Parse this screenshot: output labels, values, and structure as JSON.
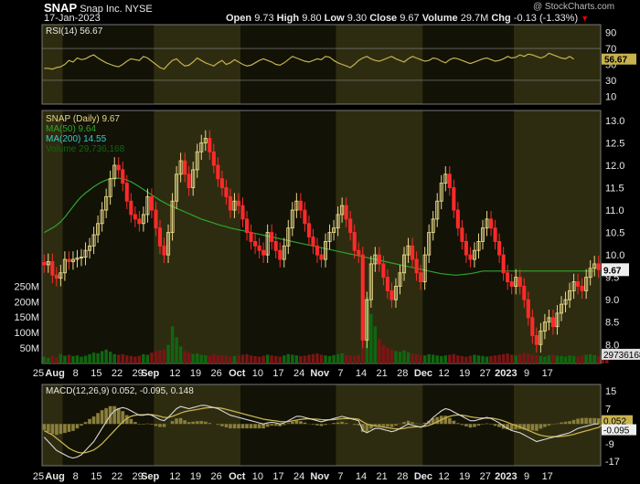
{
  "header": {
    "symbol": "SNAP",
    "company": "Snap Inc.",
    "exchange": "NYSE",
    "date": "17-Jan-2023",
    "open_label": "Open",
    "open": "9.73",
    "high_label": "High",
    "high": "9.80",
    "low_label": "Low",
    "low": "9.30",
    "close_label": "Close",
    "close": "9.67",
    "volume_label": "Volume",
    "volume": "29.7M",
    "chg_label": "Chg",
    "chg": "-0.13 (-1.33%)",
    "chg_arrow": "▼",
    "watermark": "@ StockCharts.com"
  },
  "colors": {
    "background": "#000000",
    "panel_band_dark": "#121207",
    "panel_band_light": "#2e2c10",
    "up_candle": "#e8d88a",
    "down_candle": "#ff2a2a",
    "ma50": "#2ea52e",
    "ma200": "#3ac9c9",
    "volume": "#116611",
    "rsi_line": "#c7b24f",
    "macd_line": "#d8d8d8",
    "signal_line": "#c7b24f",
    "axis_text": "#e8e8e8"
  },
  "chart_data": [
    {
      "type": "line",
      "panel": "rsi",
      "legend": "RSI(14) 56.67",
      "yticks": [
        10,
        30,
        50,
        70,
        90
      ],
      "ylim": [
        0,
        100
      ],
      "last_label": "56.67",
      "values": [
        45,
        45,
        44,
        46,
        47,
        50,
        55,
        53,
        58,
        56,
        57,
        60,
        62,
        58,
        55,
        52,
        50,
        48,
        47,
        50,
        54,
        57,
        56,
        55,
        60,
        58,
        54,
        50,
        46,
        44,
        50,
        55,
        57,
        52,
        48,
        49,
        53,
        58,
        55,
        52,
        50,
        48,
        52,
        55,
        50,
        52,
        56,
        53,
        50,
        48,
        49,
        52,
        55,
        57,
        55,
        53,
        50,
        49,
        52,
        56,
        60,
        58,
        56,
        54,
        53,
        55,
        57,
        56,
        60,
        59,
        55,
        52,
        50,
        48,
        46,
        50,
        55,
        58,
        60,
        57,
        55,
        54,
        56,
        58,
        60,
        57,
        55,
        53,
        57,
        60,
        58,
        56,
        54,
        55,
        58,
        57,
        54,
        52,
        56,
        58,
        57,
        55,
        53,
        51,
        53,
        55,
        57,
        58,
        56,
        54,
        55,
        57,
        60,
        58,
        59,
        62,
        60,
        63,
        62,
        60,
        58,
        60,
        64,
        62,
        60,
        58,
        57,
        60,
        56.67
      ]
    },
    {
      "type": "candlestick",
      "panel": "price",
      "legend": [
        "SNAP (Daily) 9.67",
        "MA(50) 9.64",
        "MA(200) 14.55",
        "Volume 29,736,168"
      ],
      "yticks": [
        "8.0",
        "8.5",
        "9.0",
        "9.5",
        "10.0",
        "10.5",
        "11.0",
        "11.5",
        "12.0",
        "12.5",
        "13.0"
      ],
      "ylim": [
        7.7,
        13.1
      ],
      "last_price_label": "9.67",
      "volume_ticks": [
        "50M",
        "100M",
        "150M",
        "200M",
        "250M"
      ],
      "volume_ylim": [
        0,
        260
      ],
      "last_volume_label": "29736168",
      "close": [
        9.78,
        9.85,
        9.55,
        9.48,
        9.6,
        9.9,
        9.85,
        9.9,
        9.93,
        9.95,
        10.1,
        10.2,
        10.45,
        10.7,
        11.0,
        11.3,
        11.7,
        12.0,
        11.9,
        11.6,
        11.2,
        10.9,
        10.8,
        10.7,
        10.9,
        11.3,
        11.0,
        10.6,
        10.2,
        10.0,
        10.5,
        11.2,
        11.8,
        12.1,
        11.8,
        11.5,
        11.9,
        12.3,
        12.5,
        12.6,
        12.3,
        12.0,
        11.7,
        11.5,
        11.3,
        11.0,
        11.2,
        11.1,
        10.8,
        10.5,
        10.3,
        10.2,
        10.1,
        10.0,
        10.5,
        10.3,
        10.1,
        9.9,
        10.2,
        10.6,
        11.0,
        11.2,
        11.0,
        10.7,
        10.4,
        10.2,
        10.0,
        9.9,
        10.3,
        10.5,
        10.6,
        10.9,
        11.1,
        10.8,
        10.5,
        10.1,
        10.0,
        8.1,
        9.0,
        9.8,
        10.0,
        9.8,
        9.5,
        9.2,
        9.0,
        9.3,
        9.6,
        10.0,
        10.2,
        9.9,
        9.6,
        9.4,
        10.0,
        10.5,
        10.8,
        11.2,
        11.6,
        11.8,
        11.5,
        11.0,
        10.6,
        10.3,
        10.0,
        9.9,
        10.1,
        10.3,
        10.6,
        10.8,
        10.6,
        10.3,
        10.0,
        9.6,
        9.4,
        9.3,
        9.5,
        9.3,
        9.0,
        8.6,
        8.2,
        8.0,
        8.3,
        8.5,
        8.6,
        8.4,
        8.7,
        8.9,
        9.0,
        9.2,
        9.4,
        9.3,
        9.2,
        9.5,
        9.7,
        9.8,
        9.67
      ],
      "ma50": [
        10.5,
        10.55,
        10.6,
        10.66,
        10.74,
        10.84,
        10.96,
        11.08,
        11.2,
        11.3,
        11.38,
        11.45,
        11.52,
        11.58,
        11.63,
        11.67,
        11.7,
        11.71,
        11.71,
        11.7,
        11.67,
        11.63,
        11.58,
        11.52,
        11.46,
        11.4,
        11.34,
        11.28,
        11.22,
        11.17,
        11.12,
        11.08,
        11.04,
        11.0,
        10.96,
        10.92,
        10.88,
        10.84,
        10.8,
        10.77,
        10.74,
        10.71,
        10.68,
        10.65,
        10.63,
        10.6,
        10.58,
        10.56,
        10.54,
        10.52,
        10.5,
        10.48,
        10.46,
        10.44,
        10.42,
        10.4,
        10.38,
        10.36,
        10.34,
        10.32,
        10.3,
        10.28,
        10.26,
        10.24,
        10.22,
        10.2,
        10.18,
        10.16,
        10.14,
        10.12,
        10.1,
        10.08,
        10.06,
        10.04,
        10.02,
        10.0,
        9.98,
        9.96,
        9.94,
        9.92,
        9.9,
        9.88,
        9.86,
        9.84,
        9.82,
        9.8,
        9.78,
        9.76,
        9.74,
        9.72,
        9.7,
        9.68,
        9.66,
        9.64,
        9.62,
        9.6,
        9.58,
        9.57,
        9.56,
        9.55,
        9.55,
        9.56,
        9.57,
        9.58,
        9.6,
        9.62,
        9.64,
        9.64,
        9.64,
        9.64,
        9.64,
        9.64,
        9.64,
        9.64,
        9.64,
        9.64,
        9.64,
        9.64,
        9.64,
        9.64,
        9.64,
        9.64,
        9.64,
        9.64,
        9.64,
        9.64,
        9.64,
        9.64,
        9.64,
        9.64,
        9.64,
        9.64,
        9.64,
        9.64
      ],
      "volume": [
        22,
        18,
        25,
        20,
        30,
        25,
        28,
        24,
        26,
        22,
        25,
        30,
        35,
        33,
        40,
        45,
        38,
        30,
        28,
        30,
        26,
        24,
        22,
        25,
        30,
        28,
        35,
        40,
        42,
        45,
        60,
        120,
        85,
        55,
        40,
        35,
        30,
        32,
        28,
        26,
        24,
        30,
        28,
        26,
        25,
        22,
        24,
        26,
        28,
        30,
        26,
        24,
        22,
        25,
        28,
        26,
        24,
        22,
        26,
        30,
        28,
        26,
        24,
        25,
        28,
        30,
        32,
        28,
        26,
        24,
        27,
        30,
        33,
        28,
        26,
        24,
        28,
        180,
        215,
        160,
        120,
        80,
        60,
        50,
        45,
        40,
        38,
        42,
        36,
        32,
        30,
        28,
        26,
        30,
        28,
        26,
        24,
        26,
        28,
        30,
        26,
        24,
        22,
        25,
        28,
        26,
        24,
        22,
        24,
        26,
        28,
        30,
        32,
        28,
        26,
        30,
        35,
        32,
        28,
        26,
        24,
        22,
        26,
        28,
        25,
        24,
        22,
        26,
        24,
        22,
        25,
        28,
        30,
        27,
        24,
        26,
        29.7
      ]
    },
    {
      "type": "line",
      "panel": "macd",
      "legend": "MACD(12,26,9) 0.052, -0.095, 0.148",
      "yticks": [
        -17,
        -9,
        -1,
        7,
        15
      ],
      "ylim": [
        -19,
        18
      ],
      "last_labels": [
        "0.052",
        "-0.095"
      ],
      "macd": [
        -6,
        -8,
        -10,
        -12,
        -13,
        -14,
        -15,
        -15.5,
        -15,
        -14,
        -12,
        -10,
        -8,
        -5,
        -2,
        1,
        4,
        6,
        7,
        7.5,
        7,
        6,
        5,
        4,
        4,
        4.5,
        4,
        3,
        2,
        1.5,
        3,
        5,
        7,
        8,
        7.5,
        7,
        7.5,
        8,
        8.5,
        8.5,
        8,
        7.5,
        7,
        6,
        5,
        4,
        3.5,
        3,
        2.5,
        2,
        1.5,
        1,
        0.5,
        0,
        0.5,
        0.8,
        0.5,
        0,
        0.5,
        1.5,
        2.5,
        3.5,
        3.5,
        3,
        2.5,
        2,
        1.5,
        1,
        1.5,
        2,
        2.5,
        3,
        3.5,
        3,
        2.5,
        2,
        1.5,
        -3,
        -4,
        -3,
        -2,
        -2,
        -2.5,
        -3,
        -3.5,
        -3,
        -2,
        -1,
        0,
        -0.5,
        -1,
        -1.5,
        -0.5,
        1,
        3,
        4.5,
        6,
        7,
        6.5,
        5.5,
        4.5,
        3.5,
        2.5,
        1.5,
        1.5,
        2,
        2.5,
        3,
        2.5,
        1.5,
        0.5,
        -1,
        -2,
        -3,
        -3.5,
        -4,
        -5,
        -6,
        -7,
        -8,
        -7.5,
        -7,
        -6.5,
        -6,
        -5.5,
        -5,
        -4.5,
        -4,
        -3,
        -2,
        -1.5,
        -1,
        -0.5,
        0,
        0.052
      ],
      "signal": [
        -3,
        -4,
        -5,
        -6.5,
        -8,
        -9.5,
        -11,
        -12,
        -12.8,
        -13.2,
        -13,
        -12.5,
        -11.8,
        -10.5,
        -9,
        -7,
        -5,
        -3,
        -1,
        1,
        2.5,
        3.5,
        4,
        4.2,
        4.2,
        4.3,
        4.3,
        4,
        3.5,
        3,
        3,
        3.5,
        4.2,
        5,
        5.6,
        6,
        6.3,
        6.6,
        7,
        7.3,
        7.5,
        7.5,
        7.4,
        7.1,
        6.7,
        6.2,
        5.7,
        5.2,
        4.7,
        4.2,
        3.7,
        3.2,
        2.7,
        2.2,
        1.9,
        1.6,
        1.4,
        1.1,
        1,
        1.1,
        1.4,
        1.8,
        2.1,
        2.3,
        2.4,
        2.3,
        2.2,
        2,
        1.9,
        1.9,
        2,
        2.2,
        2.4,
        2.5,
        2.5,
        2.4,
        2.2,
        1,
        0,
        -0.6,
        -0.9,
        -1.1,
        -1.4,
        -1.7,
        -2,
        -2.2,
        -2.2,
        -2,
        -1.6,
        -1.4,
        -1.3,
        -1.3,
        -1.1,
        -0.6,
        0.1,
        1,
        1.9,
        2.8,
        3.5,
        3.9,
        4.1,
        4,
        3.7,
        3.3,
        3,
        2.8,
        2.7,
        2.7,
        2.7,
        2.4,
        2,
        1.4,
        0.7,
        0,
        -0.7,
        -1.4,
        -2.1,
        -2.9,
        -3.7,
        -4.5,
        -5.1,
        -5.5,
        -5.7,
        -5.8,
        -5.8,
        -5.6,
        -5.4,
        -5.1,
        -4.7,
        -4.1,
        -3.6,
        -3.1,
        -2.6,
        -2.1,
        -1.6,
        -0.095
      ],
      "histogram": [
        -3,
        -4,
        -5,
        -5.5,
        -5,
        -4.5,
        -4,
        -3.5,
        -2.2,
        -0.8,
        1,
        2.5,
        3.8,
        5.5,
        7,
        8,
        9,
        9,
        8,
        6.5,
        4.5,
        2.5,
        1,
        -0.2,
        -0.2,
        0.2,
        -0.3,
        -1,
        -1.5,
        -1.5,
        0,
        1.5,
        2.8,
        3,
        1.9,
        1,
        1.2,
        1.4,
        1.5,
        1.2,
        0.5,
        0,
        -0.4,
        -1.1,
        -1.7,
        -2.2,
        -2.2,
        -2.2,
        -2.2,
        -2.2,
        -2.2,
        -2.2,
        -2.2,
        -2.2,
        -1.4,
        -0.8,
        -0.9,
        -1.1,
        -0.5,
        0.4,
        1.1,
        1.7,
        1.4,
        0.7,
        0.1,
        -0.3,
        -0.7,
        -1,
        -0.4,
        0.1,
        0.5,
        0.8,
        1.1,
        0.5,
        0,
        -0.4,
        -0.7,
        -4,
        -4,
        -2.4,
        -1.1,
        -0.9,
        -1.1,
        -1.3,
        -1.5,
        -0.8,
        0.2,
        1,
        1.6,
        0.9,
        0.3,
        -0.2,
        0.6,
        1.6,
        2.9,
        3.5,
        4.1,
        4.2,
        3,
        1.6,
        0.4,
        -0.5,
        -1.2,
        -1.8,
        -1.5,
        -0.8,
        -0.2,
        0.3,
        -0.2,
        -0.9,
        -1.5,
        -2.4,
        -2.7,
        -3,
        -2.8,
        -2.6,
        -2.9,
        -3.1,
        -3.3,
        -3.5,
        -2.4,
        -1.5,
        -0.8,
        -0.2,
        0.3,
        0.8,
        1.1,
        1.4,
        2,
        2.7,
        3,
        3.1,
        3,
        3,
        2.9,
        2.9,
        0.148
      ]
    }
  ],
  "x_axis": {
    "labels": [
      {
        "text": "25",
        "bold": false
      },
      {
        "text": "Aug",
        "bold": true
      },
      {
        "text": "8",
        "bold": false
      },
      {
        "text": "15",
        "bold": false
      },
      {
        "text": "22",
        "bold": false
      },
      {
        "text": "29",
        "bold": false
      },
      {
        "text": "Sep",
        "bold": true
      },
      {
        "text": "12",
        "bold": false
      },
      {
        "text": "19",
        "bold": false
      },
      {
        "text": "26",
        "bold": false
      },
      {
        "text": "Oct",
        "bold": true
      },
      {
        "text": "10",
        "bold": false
      },
      {
        "text": "17",
        "bold": false
      },
      {
        "text": "24",
        "bold": false
      },
      {
        "text": "Nov",
        "bold": true
      },
      {
        "text": "7",
        "bold": false
      },
      {
        "text": "14",
        "bold": false
      },
      {
        "text": "21",
        "bold": false
      },
      {
        "text": "28",
        "bold": false
      },
      {
        "text": "Dec",
        "bold": true
      },
      {
        "text": "12",
        "bold": false
      },
      {
        "text": "19",
        "bold": false
      },
      {
        "text": "27",
        "bold": false
      },
      {
        "text": "2023",
        "bold": true
      },
      {
        "text": "9",
        "bold": false
      },
      {
        "text": "17",
        "bold": false
      }
    ],
    "month_bands": [
      "Jul",
      "Aug",
      "Sep",
      "Oct",
      "Nov",
      "Dec",
      "Jan"
    ]
  }
}
